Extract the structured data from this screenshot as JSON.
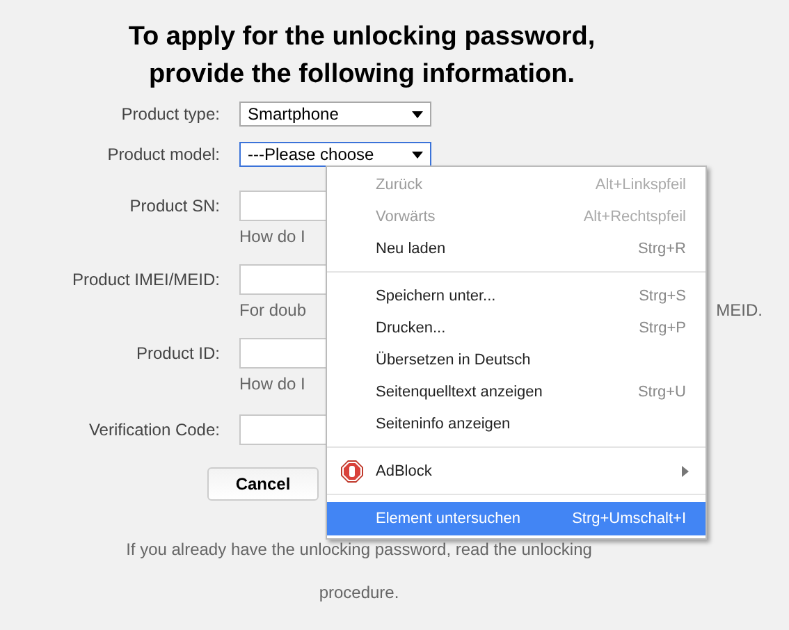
{
  "heading": [
    "To apply for the unlocking password,",
    "provide the following information."
  ],
  "form": [
    {
      "label": "Product type:",
      "kind": "select",
      "value": "Smartphone",
      "focused": false
    },
    {
      "label": "Product model:",
      "kind": "select",
      "value": "---Please choose",
      "focused": true
    },
    {
      "label": "Product SN:",
      "kind": "input",
      "hint": "How do I"
    },
    {
      "label": "Product IMEI/MEID:",
      "kind": "input",
      "hint": "For doub",
      "hint_end": "MEID."
    },
    {
      "label": "Product ID:",
      "kind": "input",
      "hint": "How do I"
    },
    {
      "label": "Verification Code:",
      "kind": "input"
    }
  ],
  "buttons": [
    "Cancel"
  ],
  "footer": "If you already have the unlocking password, read the unlocking procedure.",
  "context_menu": [
    {
      "kind": "item",
      "label": "Zurück",
      "shortcut": "Alt+Linkspfeil",
      "disabled": true,
      "selected": false
    },
    {
      "kind": "item",
      "label": "Vorwärts",
      "shortcut": "Alt+Rechtspfeil",
      "disabled": true,
      "selected": false
    },
    {
      "kind": "item",
      "label": "Neu laden",
      "shortcut": "Strg+R",
      "disabled": false,
      "selected": false
    },
    {
      "kind": "separator"
    },
    {
      "kind": "item",
      "label": "Speichern unter...",
      "shortcut": "Strg+S",
      "disabled": false,
      "selected": false
    },
    {
      "kind": "item",
      "label": "Drucken...",
      "shortcut": "Strg+P",
      "disabled": false,
      "selected": false
    },
    {
      "kind": "item",
      "label": "Übersetzen in Deutsch",
      "disabled": false,
      "selected": false
    },
    {
      "kind": "item",
      "label": "Seitenquelltext anzeigen",
      "shortcut": "Strg+U",
      "disabled": false,
      "selected": false
    },
    {
      "kind": "item",
      "label": "Seiteninfo anzeigen",
      "disabled": false,
      "selected": false
    },
    {
      "kind": "separator"
    },
    {
      "kind": "extension",
      "label": "AdBlock",
      "submenu": true,
      "disabled": false,
      "selected": false
    },
    {
      "kind": "separator"
    },
    {
      "kind": "item",
      "label": "Element untersuchen",
      "shortcut": "Strg+Umschalt+I",
      "disabled": false,
      "selected": true
    }
  ]
}
